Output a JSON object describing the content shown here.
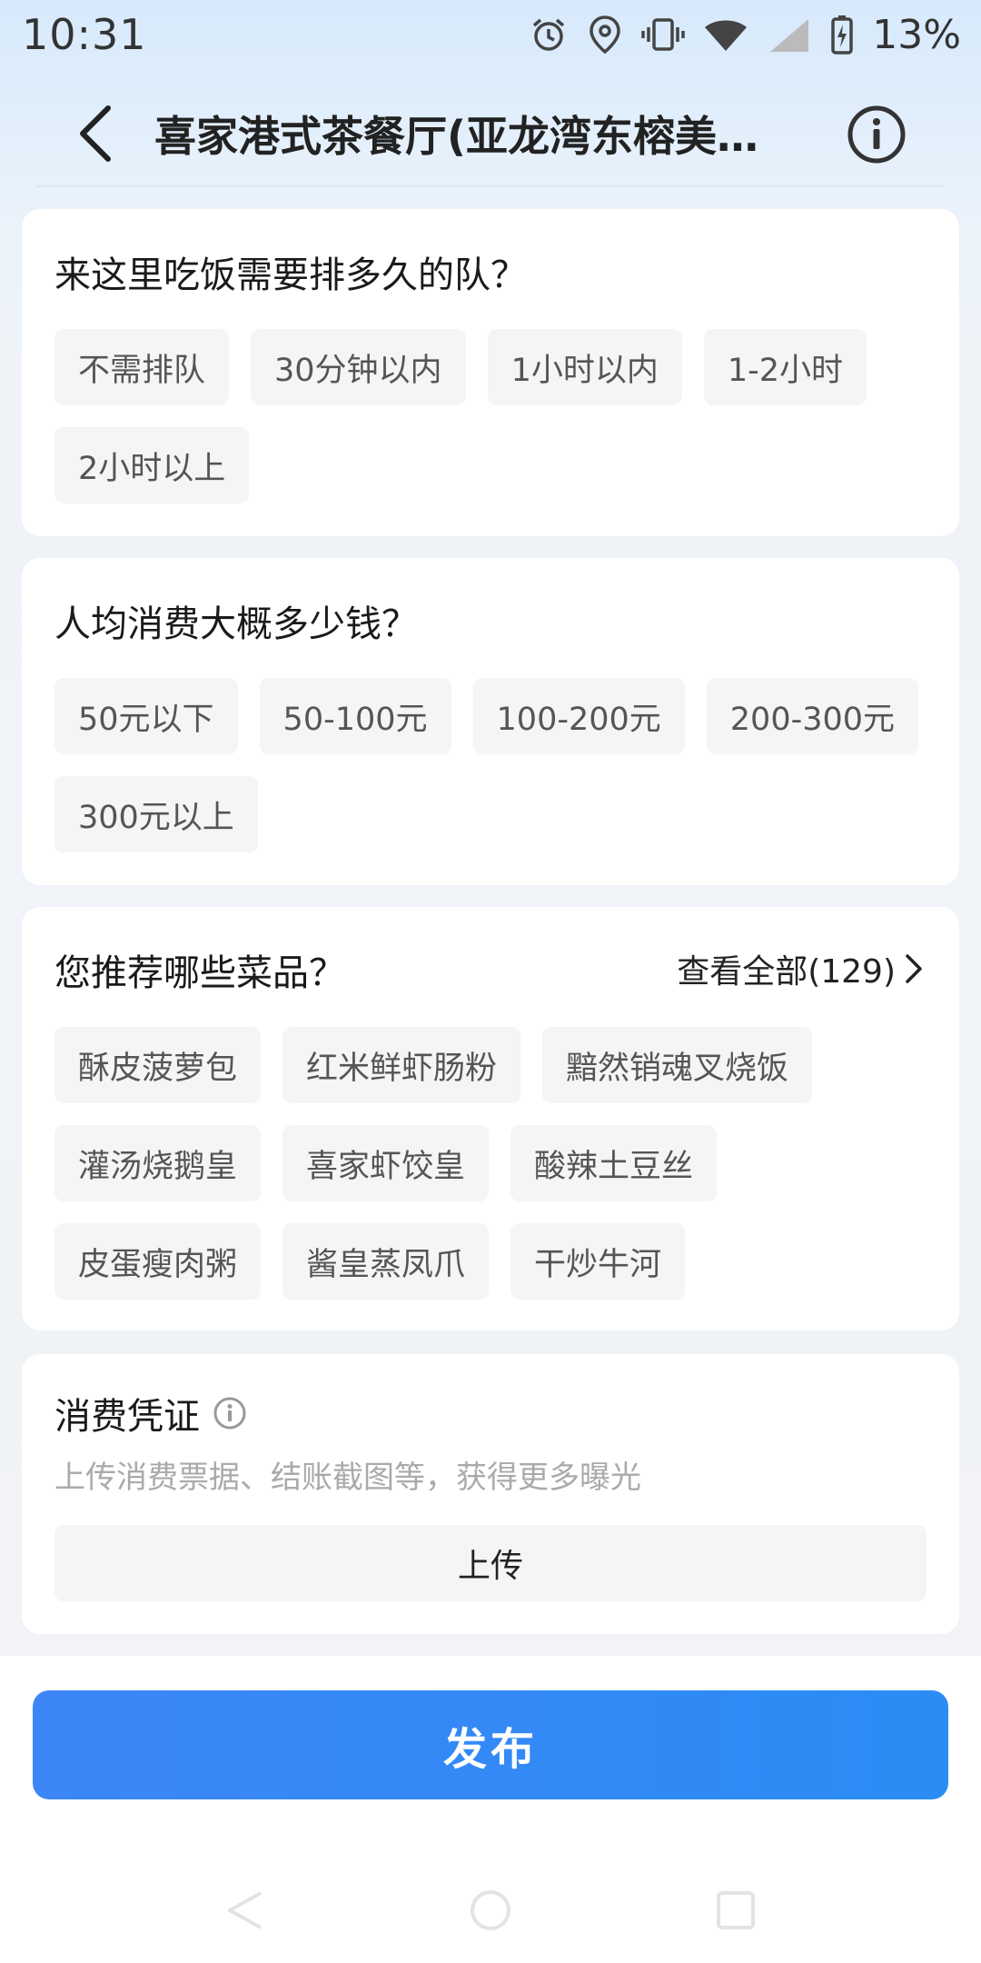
{
  "status_bar": {
    "time": "10:31",
    "battery_percent": "13%",
    "icons": [
      "alarm-icon",
      "location-icon",
      "vibrate-icon",
      "wifi-icon",
      "signal-icon",
      "battery-charging-icon"
    ]
  },
  "header": {
    "title": "喜家港式茶餐厅(亚龙湾东榕美…",
    "back_icon": "back-arrow-icon",
    "info_icon": "info-icon"
  },
  "sections": {
    "queue": {
      "question": "来这里吃饭需要排多久的队？",
      "options": [
        "不需排队",
        "30分钟以内",
        "1小时以内",
        "1-2小时",
        "2小时以上"
      ]
    },
    "price": {
      "question": "人均消费大概多少钱？",
      "options": [
        "50元以下",
        "50-100元",
        "100-200元",
        "200-300元",
        "300元以上"
      ]
    },
    "dishes": {
      "question": "您推荐哪些菜品？",
      "view_all": "查看全部(129)",
      "options": [
        "酥皮菠萝包",
        "红米鲜虾肠粉",
        "黯然销魂叉烧饭",
        "灌汤烧鹅皇",
        "喜家虾饺皇",
        "酸辣土豆丝",
        "皮蛋瘦肉粥",
        "酱皇蒸凤爪",
        "干炒牛河"
      ]
    },
    "voucher": {
      "title": "消费凭证",
      "hint": "上传消费票据、结账截图等，获得更多曝光",
      "upload_label": "上传"
    }
  },
  "publish_label": "发布",
  "colors": {
    "accent": "#3c86f5",
    "chip_bg": "#f4f5f7",
    "chip_text": "#555555",
    "hint_text": "#aaaaaa"
  }
}
